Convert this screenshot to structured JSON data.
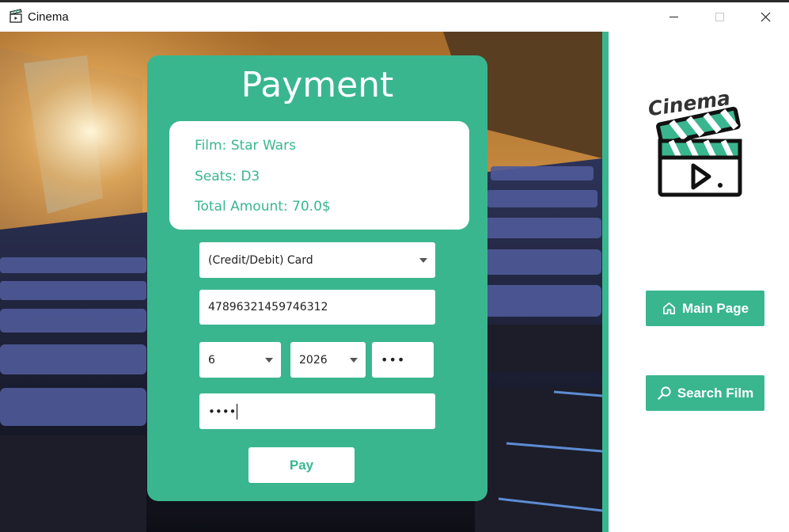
{
  "window": {
    "title": "Cinema",
    "icons": {
      "app": "clapperboard-icon",
      "minimize": "minimize-icon",
      "maximize": "maximize-icon",
      "close": "close-icon"
    }
  },
  "payment": {
    "title": "Payment",
    "summary": {
      "film_label": "Film:",
      "film": "Star Wars",
      "seats_label": "Seats:",
      "seats": "D3",
      "total_label": "Total Amount:",
      "total": "70.0$"
    },
    "method": "(Credit/Debit) Card",
    "card_number": "47896321459746312",
    "expiry_month": "6",
    "expiry_year": "2026",
    "cvv_masked": "•••",
    "pin_masked": "••••",
    "pay_label": "Pay"
  },
  "sidebar": {
    "logo_text": "Cinema",
    "main_page_label": "Main Page",
    "search_film_label": "Search Film",
    "icons": {
      "main_page": "home-icon",
      "search": "search-icon"
    }
  },
  "colors": {
    "accent": "#3ab68f",
    "white": "#ffffff"
  }
}
